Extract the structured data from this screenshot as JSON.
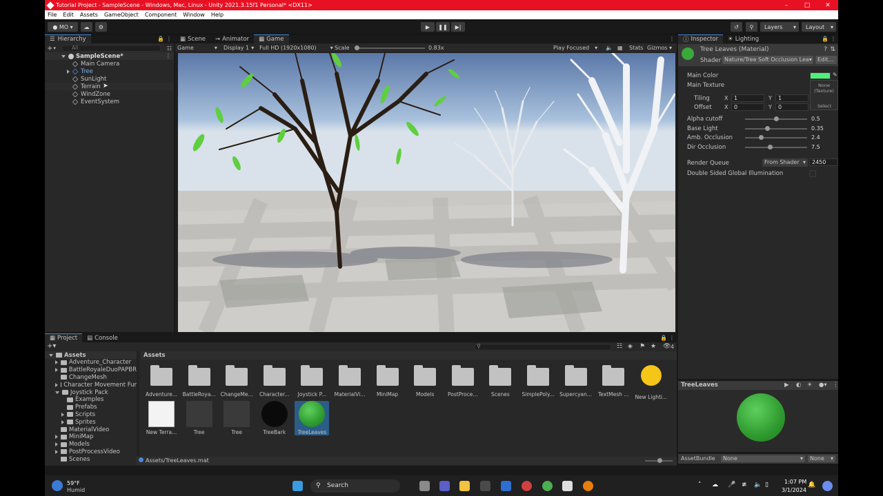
{
  "window": {
    "title": "Tutorial Project - SampleScene - Windows, Mac, Linux - Unity 2021.3.15f1 Personal* <DX11>"
  },
  "menu": [
    "File",
    "Edit",
    "Assets",
    "GameObject",
    "Component",
    "Window",
    "Help"
  ],
  "toolbar": {
    "account": "MO",
    "layers": "Layers",
    "layout": "Layout"
  },
  "hierarchy": {
    "tab": "Hierarchy",
    "search_placeholder": "All",
    "scene": "SampleScene*",
    "items": [
      "Main Camera",
      "Tree",
      "SunLight",
      "Terrain",
      "WindZone",
      "EventSystem"
    ]
  },
  "center": {
    "tabs": [
      "Scene",
      "Animator",
      "Game"
    ],
    "game_label": "Game",
    "display": "Display 1",
    "resolution": "Full HD (1920x1080)",
    "scale_label": "Scale",
    "scale_value": "0.83x",
    "play_focused": "Play Focused",
    "stats": "Stats",
    "gizmos": "Gizmos"
  },
  "inspector": {
    "tabs": [
      "Inspector",
      "Lighting"
    ],
    "material_name": "Tree Leaves (Material)",
    "shader_label": "Shader",
    "shader_value": "Nature/Tree Soft Occlusion Lea▾",
    "edit_button": "Edit...",
    "main_color": "Main Color",
    "main_texture": "Main Texture",
    "texture_none": "None (Texture)",
    "select": "Select",
    "tiling_label": "Tiling",
    "offset_label": "Offset",
    "tiling_x": "1",
    "tiling_y": "1",
    "offset_x": "0",
    "offset_y": "0",
    "props": [
      {
        "label": "Alpha cutoff",
        "value": "0.5",
        "frac": 0.5
      },
      {
        "label": "Base Light",
        "value": "0.35",
        "frac": 0.35
      },
      {
        "label": "Amb. Occlusion",
        "value": "2.4",
        "frac": 0.25
      },
      {
        "label": "Dir Occlusion",
        "value": "7.5",
        "frac": 0.4
      }
    ],
    "render_queue_label": "Render Queue",
    "render_queue_mode": "From Shader",
    "render_queue_value": "2450",
    "double_sided": "Double Sided Global Illumination",
    "preview_title": "TreeLeaves",
    "assetbundle_label": "AssetBundle",
    "assetbundle_value": "None",
    "assetbundle_variant": "None"
  },
  "project": {
    "tabs": [
      "Project",
      "Console"
    ],
    "root": "Assets",
    "tree": [
      "Assets",
      "Adventure_Character",
      "BattleRoyaleDuoPAPBR",
      "ChangeMesh",
      "Character Movement Fur",
      "Joystick Pack",
      "Examples",
      "Prefabs",
      "Scripts",
      "Sprites",
      "MaterialVideo",
      "MiniMap",
      "Models",
      "PostProcessVideo",
      "Scenes"
    ],
    "breadcrumb": "Assets",
    "folders": [
      "Adventure...",
      "BattleRoya...",
      "ChangeMe...",
      "Character...",
      "Joystick P...",
      "MaterialVi...",
      "MiniMap",
      "Models",
      "PostProce...",
      "Scenes",
      "SimplePoly...",
      "Supercyan...",
      "TextMesh ...",
      "New Lighti..."
    ],
    "files": [
      "New Terra...",
      "Tree",
      "Tree",
      "TreeBark",
      "TreeLeaves"
    ],
    "path": "Assets/TreeLeaves.mat",
    "count": "4"
  },
  "taskbar": {
    "temp": "59°F",
    "weather": "Humid",
    "search": "Search",
    "time": "1:07 PM",
    "date": "3/1/2024"
  },
  "colors": {
    "accent": "#4a88d6",
    "leaf_green": "#3aa83a",
    "titlebar": "#e81123"
  }
}
